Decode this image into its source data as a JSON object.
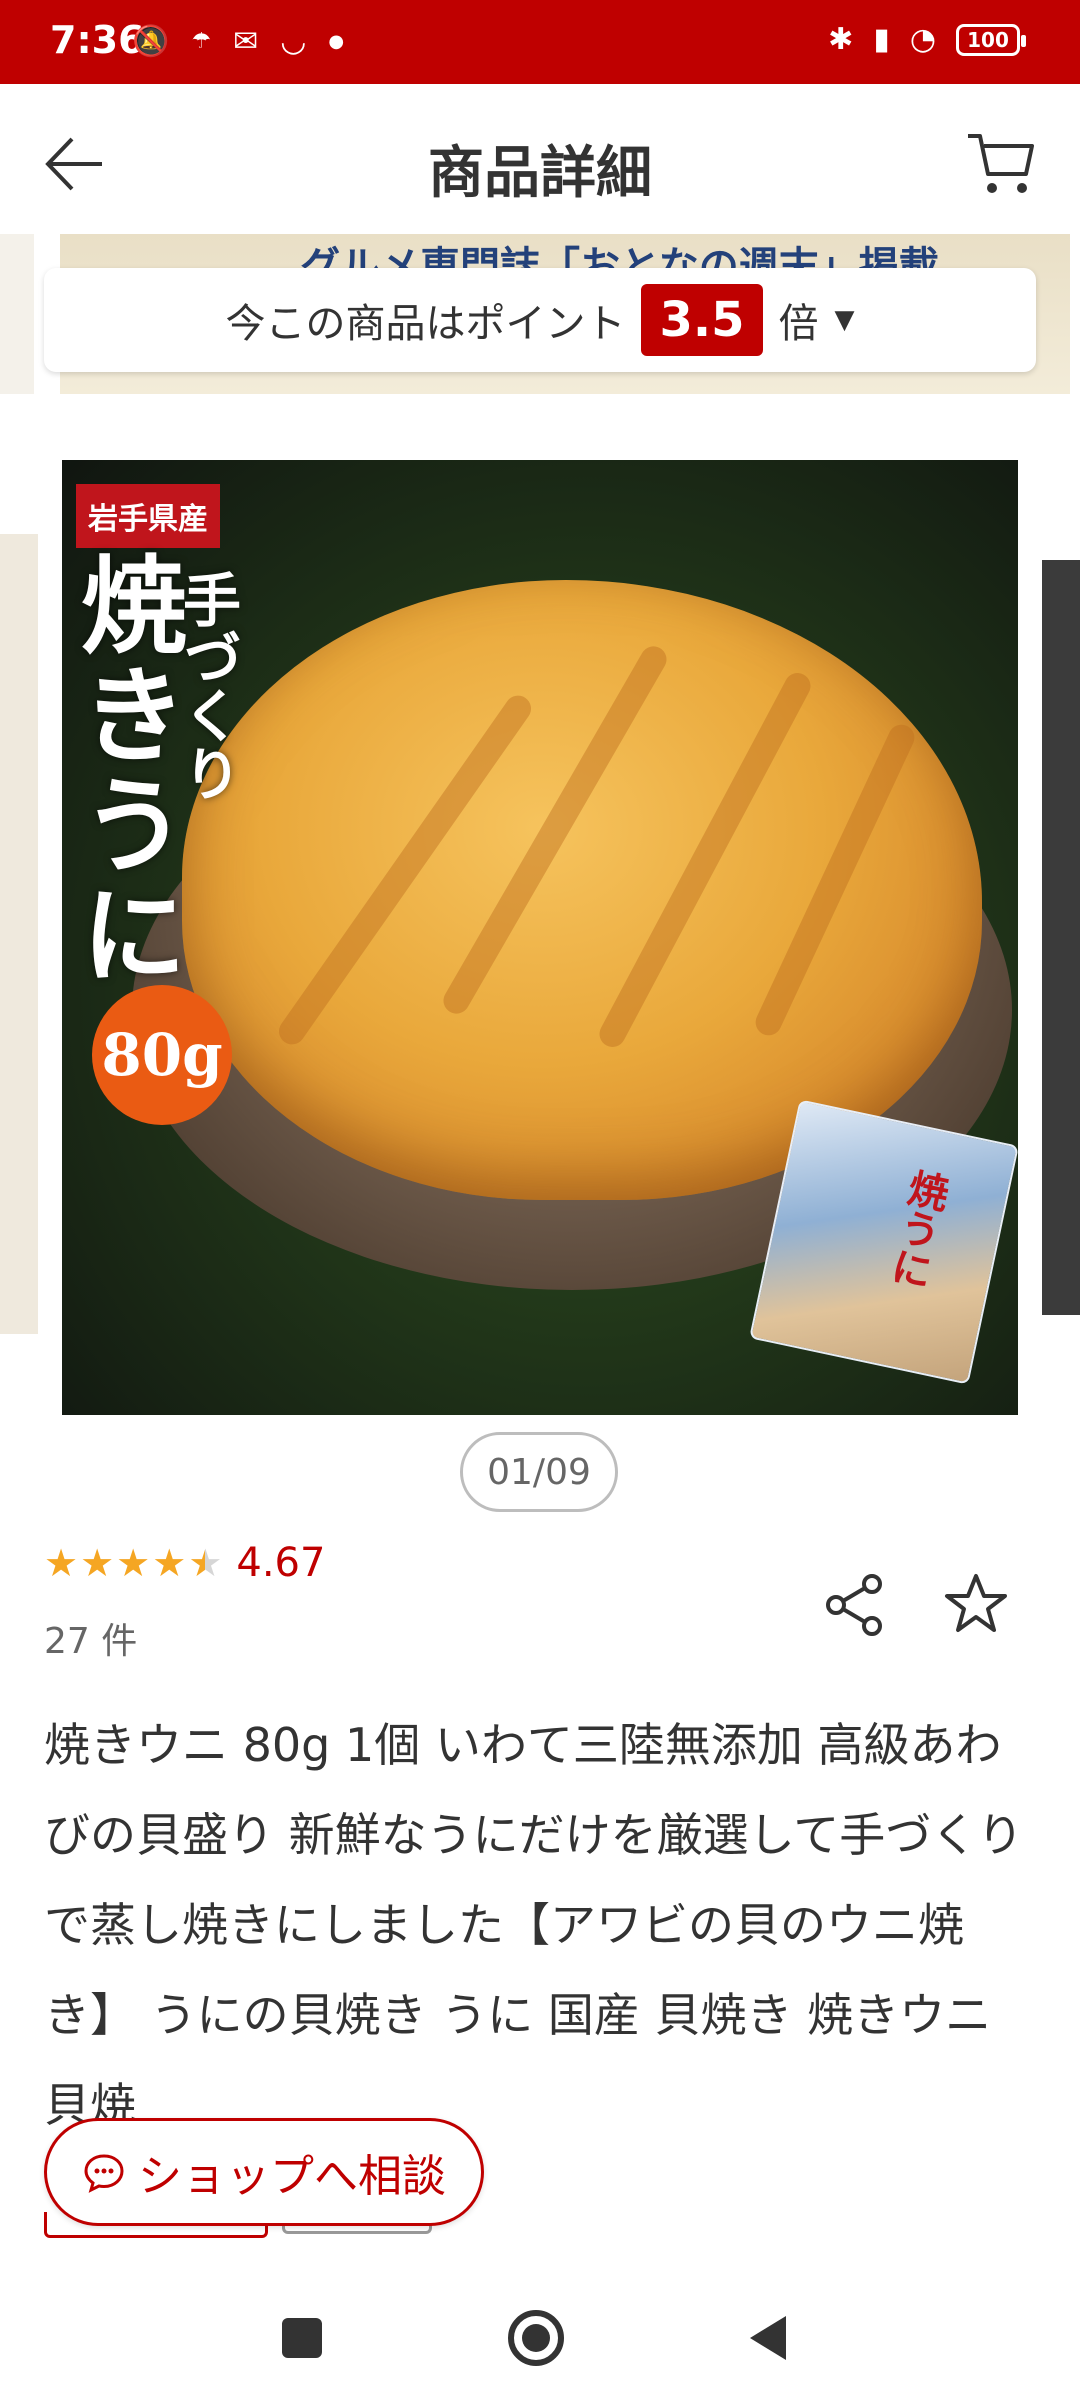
{
  "status_bar": {
    "time": "7:36",
    "battery": "100",
    "left_icons": [
      "mute-icon",
      "weather-icon",
      "mail-icon",
      "smile-icon",
      "dot-icon"
    ],
    "right_icons": [
      "bluetooth-icon",
      "signal-icon",
      "wifi-icon",
      "battery-icon"
    ]
  },
  "header": {
    "title": "商品詳細"
  },
  "banner": {
    "text": "グルメ専門誌「おとなの週末」掲載"
  },
  "points": {
    "label": "今この商品はポイント",
    "multiplier": "3.5",
    "suffix": "倍"
  },
  "product_image": {
    "origin_badge": "岩手県産",
    "title_small": "手づくり",
    "title_big": "焼きうに",
    "weight_badge": "80g",
    "package_text": "焼うに"
  },
  "pager": {
    "text": "01/09"
  },
  "rating": {
    "value": "4.67",
    "stars": 4.67,
    "count_label": "27 件"
  },
  "product": {
    "title": "焼きウニ 80g 1個 いわて三陸無添加 高級あわびの貝盛り 新鮮なうにだけを厳選して手づくりで蒸し焼きにしました【アワビの貝のウニ焼き】 うにの貝焼き うに 国産 貝焼き 焼きウニ 貝焼"
  },
  "chat": {
    "label": "ショップへ相談"
  },
  "colors": {
    "brand": "#bf0000",
    "star": "#f5a623",
    "weight_badge": "#ea5b13"
  }
}
